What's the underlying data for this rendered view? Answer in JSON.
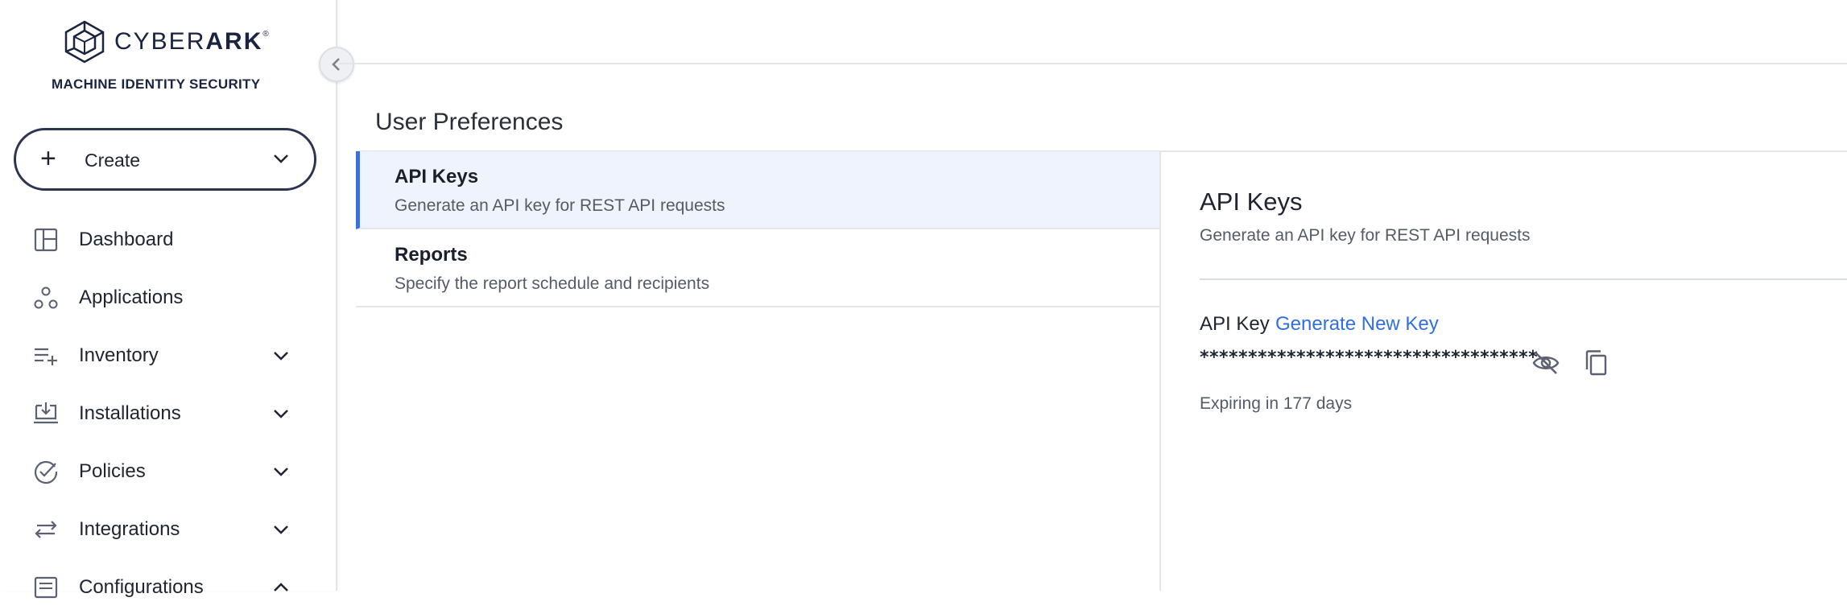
{
  "brand": {
    "logo_text_light": "CYBER",
    "logo_text_bold": "ARK",
    "trademark": "®",
    "tagline": "MACHINE IDENTITY SECURITY"
  },
  "sidebar": {
    "create_label": "Create",
    "items": [
      {
        "label": "Dashboard",
        "icon": "dashboard-icon",
        "has_chevron": false
      },
      {
        "label": "Applications",
        "icon": "applications-icon",
        "has_chevron": false
      },
      {
        "label": "Inventory",
        "icon": "inventory-icon",
        "has_chevron": true,
        "chevron": "down"
      },
      {
        "label": "Installations",
        "icon": "installations-icon",
        "has_chevron": true,
        "chevron": "down"
      },
      {
        "label": "Policies",
        "icon": "policies-icon",
        "has_chevron": true,
        "chevron": "down"
      },
      {
        "label": "Integrations",
        "icon": "integrations-icon",
        "has_chevron": true,
        "chevron": "down"
      },
      {
        "label": "Configurations",
        "icon": "configurations-icon",
        "has_chevron": true,
        "chevron": "up"
      }
    ]
  },
  "main": {
    "page_title": "User Preferences",
    "preferences": [
      {
        "title": "API Keys",
        "description": "Generate an API key for REST API requests",
        "active": true
      },
      {
        "title": "Reports",
        "description": "Specify the report schedule and recipients",
        "active": false
      }
    ],
    "detail": {
      "title": "API Keys",
      "description": "Generate an API key for REST API requests",
      "key_label": "API Key",
      "generate_link": "Generate New Key",
      "masked_key": "***********************************",
      "expiry": "Expiring in 177 days"
    }
  },
  "colors": {
    "accent": "#3d6fd8",
    "link": "#2f6fe0",
    "active_bg": "#eef3fd",
    "text": "#1f2430"
  }
}
